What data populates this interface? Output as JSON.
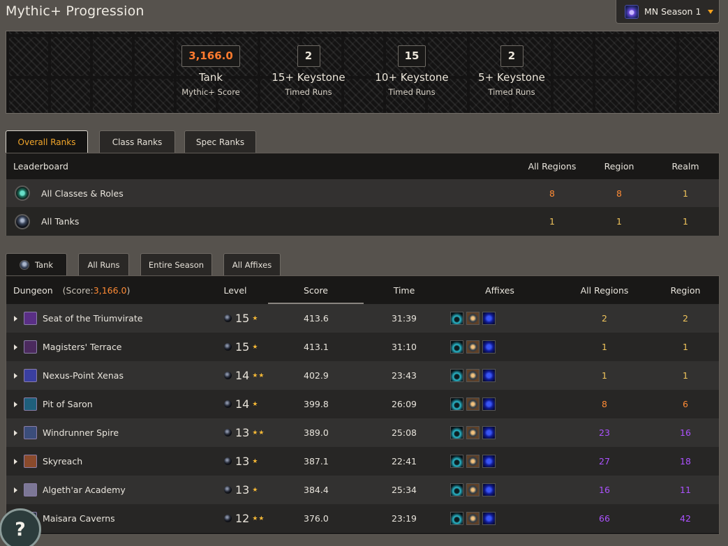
{
  "page": {
    "title": "Mythic+ Progression"
  },
  "season": {
    "label": "MN Season 1",
    "icon": "season-icon"
  },
  "summary": {
    "stats": [
      {
        "value": "3,166.0",
        "main": "Tank",
        "sub": "Mythic+ Score"
      },
      {
        "value": "2",
        "main": "15+ Keystone",
        "sub": "Timed Runs"
      },
      {
        "value": "15",
        "main": "10+ Keystone",
        "sub": "Timed Runs"
      },
      {
        "value": "2",
        "main": "5+ Keystone",
        "sub": "Timed Runs"
      }
    ]
  },
  "rank_tabs": [
    "Overall Ranks",
    "Class Ranks",
    "Spec Ranks"
  ],
  "leaderboard": {
    "headers": {
      "name": "Leaderboard",
      "all": "All Regions",
      "region": "Region",
      "realm": "Realm"
    },
    "rows": [
      {
        "icon": "classes-roles-icon",
        "name": "All Classes & Roles",
        "all": "8",
        "region": "8",
        "realm": "1"
      },
      {
        "icon": "tank-icon",
        "name": "All Tanks",
        "all": "1",
        "region": "1",
        "realm": "1"
      }
    ]
  },
  "filter_tabs": [
    "Tank",
    "All Runs",
    "Entire Season",
    "All Affixes"
  ],
  "runs": {
    "headers": {
      "dungeon": "Dungeon",
      "score_label_prefix": "(Score: ",
      "score_value": "3,166.0",
      "score_label_suffix": ")",
      "level": "Level",
      "score": "Score",
      "time": "Time",
      "affixes": "Affixes",
      "all_regions": "All Regions",
      "region": "Region"
    },
    "rows": [
      {
        "dungeon": "Seat of the Triumvirate",
        "level": "15",
        "stars": "★",
        "score": "413.6",
        "time": "31:39",
        "all": "2",
        "region": "2",
        "tier": "gold"
      },
      {
        "dungeon": "Magisters' Terrace",
        "level": "15",
        "stars": "★",
        "score": "413.1",
        "time": "31:10",
        "all": "1",
        "region": "1",
        "tier": "gold"
      },
      {
        "dungeon": "Nexus-Point Xenas",
        "level": "14",
        "stars": "★★",
        "score": "402.9",
        "time": "23:43",
        "all": "1",
        "region": "1",
        "tier": "gold"
      },
      {
        "dungeon": "Pit of Saron",
        "level": "14",
        "stars": "★",
        "score": "399.8",
        "time": "26:09",
        "all": "8",
        "region": "6",
        "tier": "orange"
      },
      {
        "dungeon": "Windrunner Spire",
        "level": "13",
        "stars": "★★",
        "score": "389.0",
        "time": "25:08",
        "all": "23",
        "region": "16",
        "tier": "purple"
      },
      {
        "dungeon": "Skyreach",
        "level": "13",
        "stars": "★",
        "score": "387.1",
        "time": "22:41",
        "all": "27",
        "region": "18",
        "tier": "purple"
      },
      {
        "dungeon": "Algeth'ar Academy",
        "level": "13",
        "stars": "★",
        "score": "384.4",
        "time": "25:34",
        "all": "16",
        "region": "11",
        "tier": "purple"
      },
      {
        "dungeon": "Maisara Caverns",
        "level": "12",
        "stars": "★★",
        "score": "376.0",
        "time": "23:19",
        "all": "66",
        "region": "42",
        "tier": "purple"
      }
    ]
  },
  "help": {
    "label": "?"
  },
  "colors": {
    "orange": "#ff8b35",
    "gold": "#f1c55b",
    "purple": "#ac52ff",
    "accent": "#f2a62a"
  }
}
